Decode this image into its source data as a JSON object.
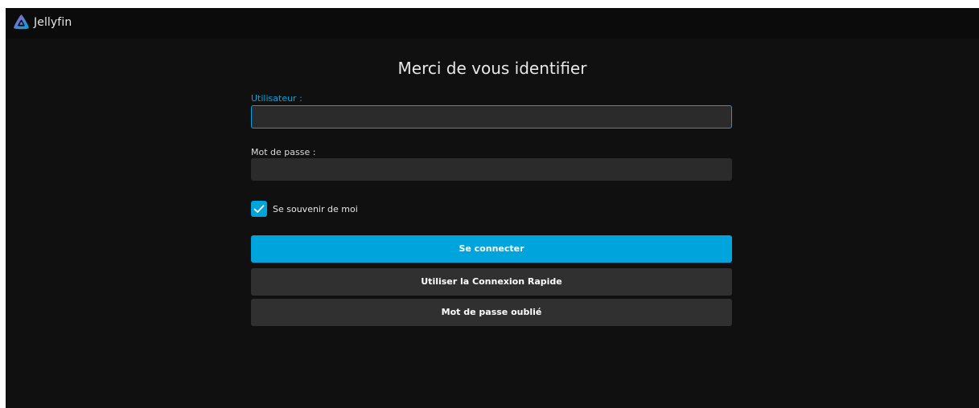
{
  "header": {
    "brand": "Jellyfin",
    "logo_icon": "jellyfin-logo-icon"
  },
  "login": {
    "title": "Merci de vous identifier",
    "username_label": "Utilisateur :",
    "username_value": "",
    "password_label": "Mot de passe :",
    "password_value": "",
    "remember_label": "Se souvenir de moi",
    "remember_checked": true,
    "signin_button": "Se connecter",
    "quick_connect_button": "Utiliser la Connexion Rapide",
    "forgot_password_button": "Mot de passe oublié"
  },
  "colors": {
    "accent": "#00a4dc",
    "background": "#101010",
    "header": "#0b0b0b",
    "input": "#2b2b2b",
    "secondary_button": "#303030"
  }
}
